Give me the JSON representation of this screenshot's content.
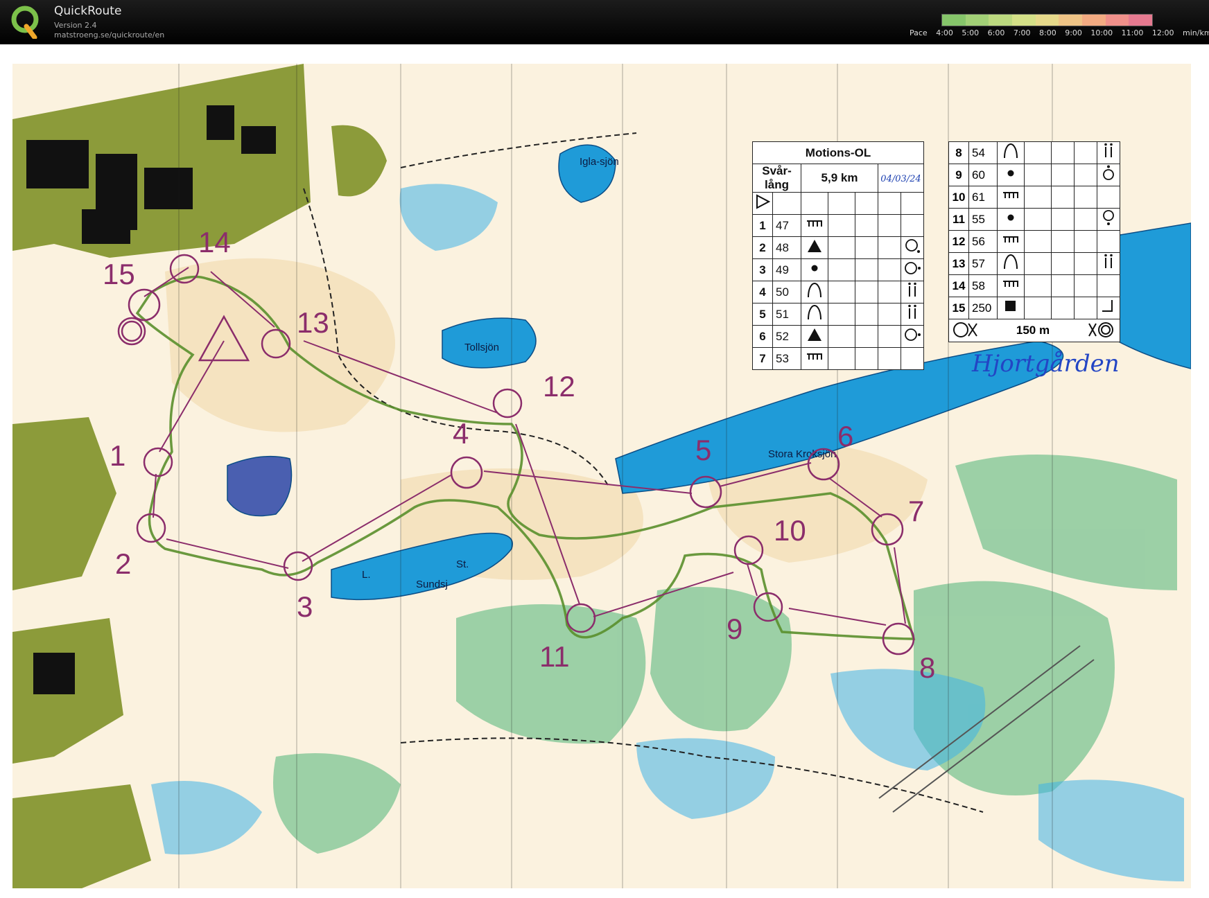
{
  "app": {
    "title": "QuickRoute",
    "version": "Version 2.4",
    "url": "matstroeng.se/quickroute/en"
  },
  "pace_scale": {
    "label": "Pace",
    "ticks": [
      "4:00",
      "5:00",
      "6:00",
      "7:00",
      "8:00",
      "9:00",
      "10:00",
      "11:00",
      "12:00"
    ],
    "unit": "min/km",
    "colors": [
      "#86c56a",
      "#a2d076",
      "#bcd97f",
      "#d4e087",
      "#e6d98a",
      "#efc486",
      "#f3ab82",
      "#f0908a",
      "#e67a90"
    ]
  },
  "map": {
    "lakes": [
      "Igla-sjön",
      "Tollsjön",
      "Stora Kroksjön",
      "L.",
      "St.",
      "Sundsj"
    ],
    "controls": [
      "1",
      "2",
      "3",
      "4",
      "5",
      "6",
      "7",
      "8",
      "9",
      "10",
      "11",
      "12",
      "13",
      "14",
      "15"
    ],
    "handwritten_place": "Hjortgården",
    "colors": {
      "course": "#8b2d6b",
      "route": "#4d8a2c",
      "water": "#1f9bd8",
      "open": "#f7e7c8",
      "forest": "#ffffff",
      "green": "#7fc48a",
      "urban": "#8c9b3a"
    }
  },
  "description_sheet": {
    "event": "Motions-OL",
    "course": "Svår-lång",
    "length": "5,9 km",
    "date": "04/03/24",
    "left_rows": [
      {
        "n": "1",
        "code": "47",
        "sym": "knoll-edge",
        "extra": ""
      },
      {
        "n": "2",
        "code": "48",
        "sym": "triangle",
        "extra": "circle-dot-se"
      },
      {
        "n": "3",
        "code": "49",
        "sym": "dot",
        "extra": "circle-dot-e"
      },
      {
        "n": "4",
        "code": "50",
        "sym": "arch",
        "extra": "bar-pair"
      },
      {
        "n": "5",
        "code": "51",
        "sym": "arch",
        "extra": "bar-pair"
      },
      {
        "n": "6",
        "code": "52",
        "sym": "triangle",
        "extra": "circle-dot-e"
      },
      {
        "n": "7",
        "code": "53",
        "sym": "knoll-edge",
        "extra": ""
      }
    ],
    "right_rows": [
      {
        "n": "8",
        "code": "54",
        "sym": "arch",
        "extra": "bar-pair"
      },
      {
        "n": "9",
        "code": "60",
        "sym": "dot",
        "extra": "circle-dot-n"
      },
      {
        "n": "10",
        "code": "61",
        "sym": "knoll-edge",
        "extra": ""
      },
      {
        "n": "11",
        "code": "55",
        "sym": "dot",
        "extra": "circle-dot-s"
      },
      {
        "n": "12",
        "code": "56",
        "sym": "knoll-edge",
        "extra": ""
      },
      {
        "n": "13",
        "code": "57",
        "sym": "arch",
        "extra": "bar-pair"
      },
      {
        "n": "14",
        "code": "58",
        "sym": "knoll-edge",
        "extra": ""
      },
      {
        "n": "15",
        "code": "250",
        "sym": "square",
        "extra": "corner"
      }
    ],
    "finish": "150 m"
  }
}
